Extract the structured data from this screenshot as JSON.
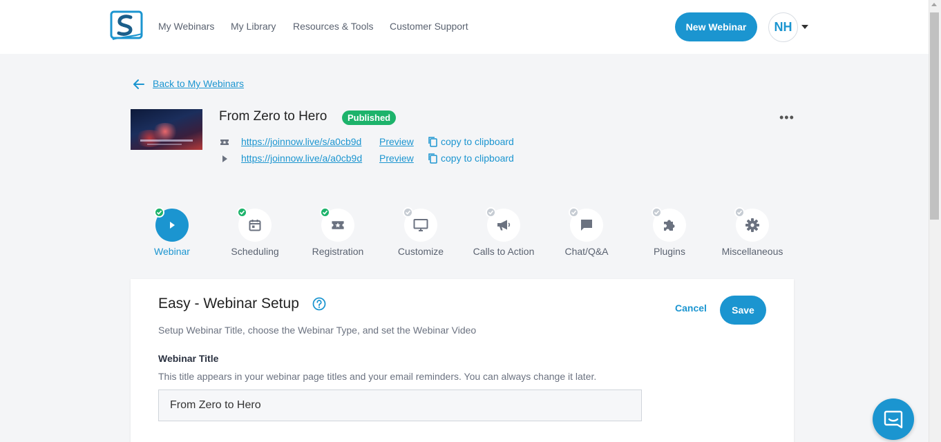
{
  "nav": {
    "links": [
      "My Webinars",
      "My Library",
      "Resources & Tools",
      "Customer Support"
    ],
    "new_webinar_label": "New Webinar",
    "avatar_initials": "NH"
  },
  "back": {
    "label": "Back to My Webinars"
  },
  "webinar": {
    "title": "From Zero to Hero",
    "status": "Published",
    "links": [
      {
        "icon": "ticket-icon",
        "url": "https://joinnow.live/s/a0cb9d",
        "preview": "Preview",
        "copy": "copy to clipboard"
      },
      {
        "icon": "play-icon",
        "url": "https://joinnow.live/a/a0cb9d",
        "preview": "Preview",
        "copy": "copy to clipboard"
      }
    ]
  },
  "steps": [
    {
      "label": "Webinar",
      "icon": "play-icon",
      "state": "done",
      "active": true
    },
    {
      "label": "Scheduling",
      "icon": "calendar-icon",
      "state": "done",
      "active": false
    },
    {
      "label": "Registration",
      "icon": "ticket-icon",
      "state": "done",
      "active": false
    },
    {
      "label": "Customize",
      "icon": "monitor-icon",
      "state": "pending",
      "active": false
    },
    {
      "label": "Calls to Action",
      "icon": "megaphone-icon",
      "state": "pending",
      "active": false
    },
    {
      "label": "Chat/Q&A",
      "icon": "chat-icon",
      "state": "pending",
      "active": false
    },
    {
      "label": "Plugins",
      "icon": "puzzle-icon",
      "state": "pending",
      "active": false
    },
    {
      "label": "Miscellaneous",
      "icon": "gear-icon",
      "state": "pending",
      "active": false
    }
  ],
  "card": {
    "title": "Easy - Webinar Setup",
    "subtitle": "Setup Webinar Title, choose the Webinar Type, and set the Webinar Video",
    "cancel_label": "Cancel",
    "save_label": "Save",
    "field": {
      "label": "Webinar Title",
      "help": "This title appears in your webinar page titles and your email reminders. You can always change it later.",
      "value": "From Zero to Hero"
    }
  },
  "colors": {
    "accent": "#1b95d0",
    "success": "#1db36b",
    "pending": "#c6ccd3"
  }
}
